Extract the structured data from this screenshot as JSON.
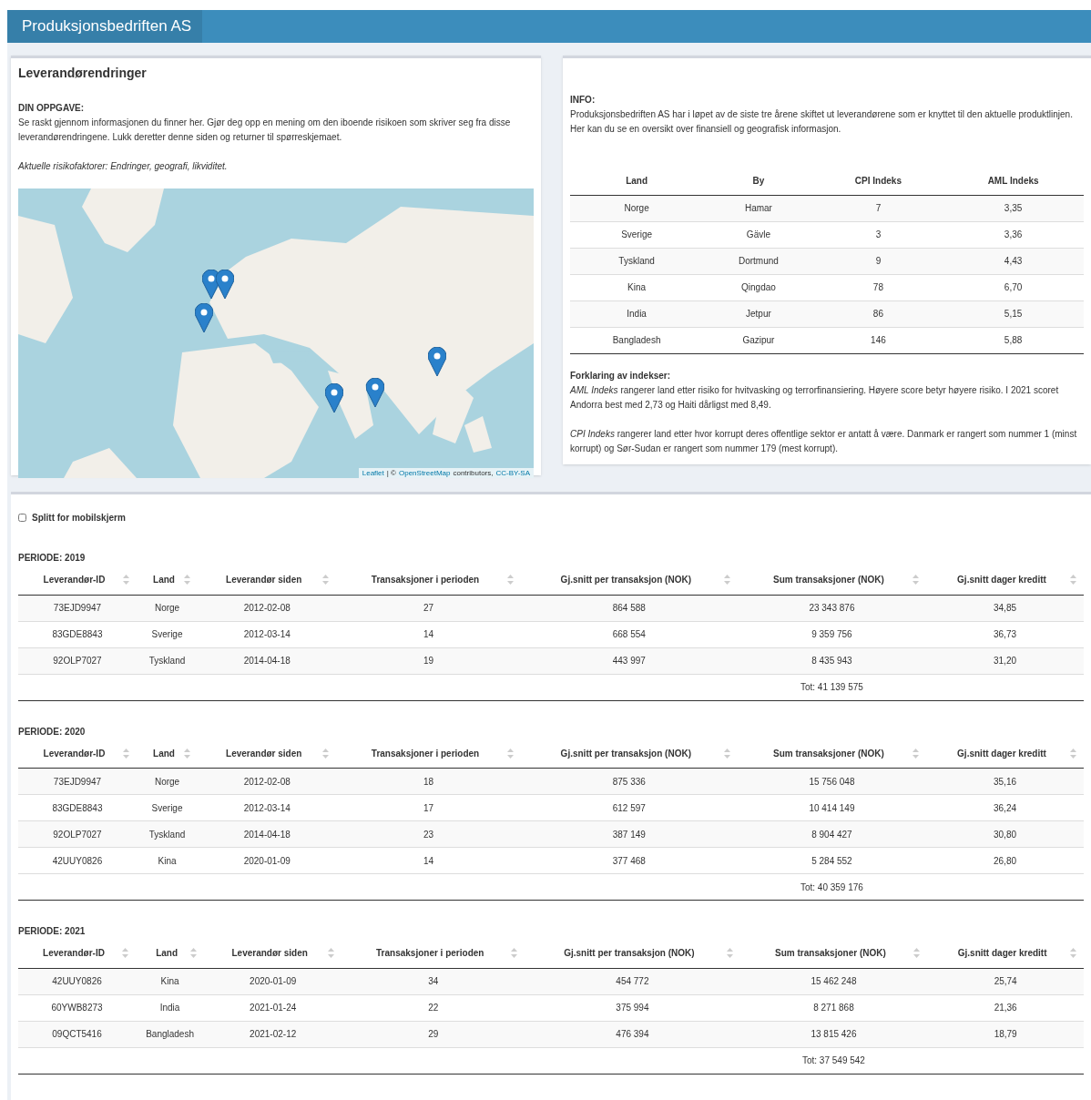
{
  "header": {
    "title": "Produksjonsbedriften AS"
  },
  "task_panel": {
    "title": "Leverandørendringer",
    "heading": "DIN OPPGAVE:",
    "text": "Se raskt gjennom informasjonen du finner her. Gjør deg opp en mening om den iboende risikoen som skriver seg fra disse leverandørendringene. Lukk deretter denne siden og returner til spørreskjemaet.",
    "risk_factors": "Aktuelle risikofaktorer: Endringer, geografi, likviditet.",
    "map": {
      "kind": "picture",
      "attribution": [
        {
          "text": "Leaflet",
          "link": true
        },
        {
          "text": "| ©",
          "link": false
        },
        {
          "text": "OpenStreetMap",
          "link": true
        },
        {
          "text": "contributors,",
          "link": false
        },
        {
          "text": "CC-BY-SA",
          "link": true
        }
      ]
    }
  },
  "info_panel": {
    "heading": "INFO:",
    "text": "Produksjonsbedriften AS har i løpet av de siste tre årene skiftet ut leverandørene som er knyttet til den aktuelle produktlinjen. Her kan du se en oversikt over finansiell og geografisk informasjon.",
    "table": {
      "columns": [
        "Land",
        "By",
        "CPI Indeks",
        "AML Indeks"
      ],
      "rows": [
        [
          "Norge",
          "Hamar",
          "7",
          "3,35"
        ],
        [
          "Sverige",
          "Gävle",
          "3",
          "3,36"
        ],
        [
          "Tyskland",
          "Dortmund",
          "9",
          "4,43"
        ],
        [
          "Kina",
          "Qingdao",
          "78",
          "6,70"
        ],
        [
          "India",
          "Jetpur",
          "86",
          "5,15"
        ],
        [
          "Bangladesh",
          "Gazipur",
          "146",
          "5,88"
        ]
      ]
    },
    "legend_heading": "Forklaring av indekser:",
    "legend": [
      "*AML Indeks* rangerer land etter risiko for hvitvasking og terrorfinansiering. Høyere score betyr høyere risiko. I 2021 scoret Andorra best med 2,73 og Haiti dårligst med 8,49.",
      "*CPI Indeks* rangerer land etter hvor korrupt deres offentlige sektor er antatt å være. Danmark er rangert som nummer 1 (minst korrupt) og Sør-Sudan er rangert som nummer 179 (mest korrupt)."
    ]
  },
  "mobile_split": {
    "label": "Splitt for mobilskjerm",
    "checked": false
  },
  "periods": [
    {
      "title": "PERIODE: 2019",
      "columns": [
        "Leverandør-ID",
        "Land",
        "Leverandør siden",
        "Transaksjoner i perioden",
        "Gj.snitt per transaksjon (NOK)",
        "Sum transaksjoner (NOK)",
        "Gj.snitt dager kreditt"
      ],
      "rows": [
        [
          "73EJD9947",
          "Norge",
          "2012-02-08",
          "27",
          "864 588",
          "23 343 876",
          "34,85"
        ],
        [
          "83GDE8843",
          "Sverige",
          "2012-03-14",
          "14",
          "668 554",
          "9 359 756",
          "36,73"
        ],
        [
          "92OLP7027",
          "Tyskland",
          "2014-04-18",
          "19",
          "443 997",
          "8 435 943",
          "31,20"
        ]
      ],
      "total": "Tot: 41 139 575"
    },
    {
      "title": "PERIODE: 2020",
      "columns": [
        "Leverandør-ID",
        "Land",
        "Leverandør siden",
        "Transaksjoner i perioden",
        "Gj.snitt per transaksjon (NOK)",
        "Sum transaksjoner (NOK)",
        "Gj.snitt dager kreditt"
      ],
      "rows": [
        [
          "73EJD9947",
          "Norge",
          "2012-02-08",
          "18",
          "875 336",
          "15 756 048",
          "35,16"
        ],
        [
          "83GDE8843",
          "Sverige",
          "2012-03-14",
          "17",
          "612 597",
          "10 414 149",
          "36,24"
        ],
        [
          "92OLP7027",
          "Tyskland",
          "2014-04-18",
          "23",
          "387 149",
          "8 904 427",
          "30,80"
        ],
        [
          "42UUY0826",
          "Kina",
          "2020-01-09",
          "14",
          "377 468",
          "5 284 552",
          "26,80"
        ]
      ],
      "total": "Tot: 40 359 176"
    },
    {
      "title": "PERIODE: 2021",
      "columns": [
        "Leverandør-ID",
        "Land",
        "Leverandør siden",
        "Transaksjoner i perioden",
        "Gj.snitt per transaksjon (NOK)",
        "Sum transaksjoner (NOK)",
        "Gj.snitt dager kreditt"
      ],
      "rows": [
        [
          "42UUY0826",
          "Kina",
          "2020-01-09",
          "34",
          "454 772",
          "15 462 248",
          "25,74"
        ],
        [
          "60YWB8273",
          "India",
          "2021-01-24",
          "22",
          "375 994",
          "8 271 868",
          "21,36"
        ],
        [
          "09QCT5416",
          "Bangladesh",
          "2021-02-12",
          "29",
          "476 394",
          "13 815 426",
          "18,79"
        ]
      ],
      "total": "Tot: 37 549 542"
    }
  ]
}
